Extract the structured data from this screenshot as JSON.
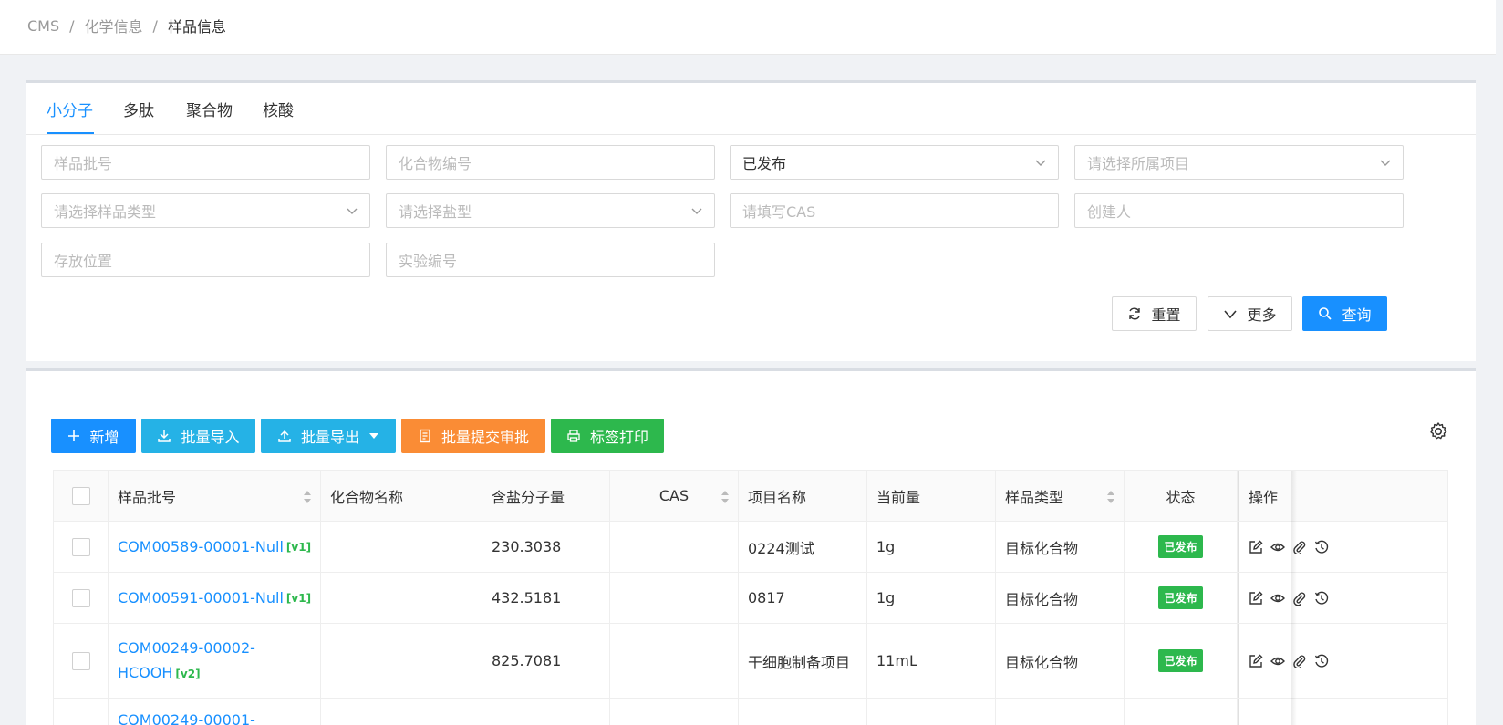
{
  "breadcrumb": [
    "CMS",
    "化学信息",
    "样品信息"
  ],
  "breadcrumb_sep": "/",
  "tabs": [
    {
      "label": "小分子",
      "active": true
    },
    {
      "label": "多肽",
      "active": false
    },
    {
      "label": "聚合物",
      "active": false
    },
    {
      "label": "核酸",
      "active": false
    }
  ],
  "filters": {
    "batch_no": "样品批号",
    "compound_no": "化合物编号",
    "status_value": "已发布",
    "project": "请选择所属项目",
    "sample_type": "请选择样品类型",
    "salt_type": "请选择盐型",
    "cas": "请填写CAS",
    "creator": "创建人",
    "location": "存放位置",
    "experiment_no": "实验编号"
  },
  "filter_buttons": {
    "reset": "重置",
    "more": "更多",
    "search": "查询"
  },
  "toolbar": {
    "add": "新增",
    "import": "批量导入",
    "export": "批量导出",
    "submit": "批量提交审批",
    "print": "标签打印",
    "colors": {
      "add": "#1890ff",
      "import": "#25b2e6",
      "export": "#25b2e6",
      "submit": "#fa8c35",
      "print": "#2db84d"
    }
  },
  "columns": [
    "样品批号",
    "化合物名称",
    "含盐分子量",
    "CAS",
    "项目名称",
    "当前量",
    "样品类型",
    "状态",
    "操作"
  ],
  "rows": [
    {
      "batch": "COM00589-00001-Null",
      "ver": "[v1]",
      "name": "",
      "mw": "230.3038",
      "cas": "",
      "project": "0224测试",
      "qty": "1g",
      "type": "目标化合物",
      "status": "已发布"
    },
    {
      "batch": "COM00591-00001-Null",
      "ver": "[v1]",
      "name": "",
      "mw": "432.5181",
      "cas": "",
      "project": "0817",
      "qty": "1g",
      "type": "目标化合物",
      "status": "已发布"
    },
    {
      "batch_line1": "COM00249-00002-",
      "batch_line2": "HCOOH",
      "ver": "[v2]",
      "name": "",
      "mw": "825.7081",
      "cas": "",
      "project": "干细胞制备项目",
      "qty": "11mL",
      "type": "目标化合物",
      "status": "已发布"
    },
    {
      "batch": "COM00249-00001-"
    }
  ]
}
